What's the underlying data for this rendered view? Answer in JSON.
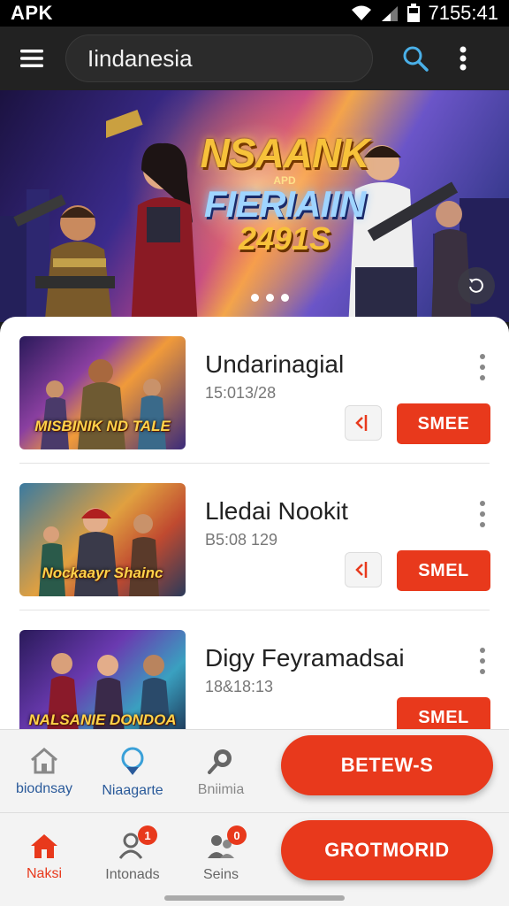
{
  "status_bar": {
    "carrier": "APK",
    "time": "7155:41"
  },
  "toolbar": {
    "search_value": "Iindanesia"
  },
  "banner": {
    "title_line1": "NSAANK",
    "title_line2": "APD",
    "title_line3": "FIERIAIIN",
    "title_line4": "2491S",
    "slide_count": 3
  },
  "games": [
    {
      "title": "Undarinagial",
      "time": "15:013/28",
      "thumb_caption": "MISBINIK ND TALE",
      "action_label": "SMEE"
    },
    {
      "title": "Lledai Nookit",
      "time": "B5:08 129",
      "thumb_caption": "Nockaayr Shainc",
      "action_label": "SMEL"
    },
    {
      "title": "Digy Feyramadsai",
      "time": "18&18:13",
      "thumb_caption": "NALSANIE DONDOA",
      "action_label": "SMEL"
    }
  ],
  "nav_top": [
    {
      "label": "biodnsay",
      "icon": "home-outline-icon",
      "color": "#2a5a9a"
    },
    {
      "label": "Niaagarte",
      "icon": "location-icon",
      "color": "#2a5a9a"
    },
    {
      "label": "Bniimia",
      "icon": "search-icon",
      "color": "#888888"
    }
  ],
  "nav_bottom": [
    {
      "label": "Naksi",
      "icon": "home-icon",
      "color": "#e8391c",
      "badge": ""
    },
    {
      "label": "Intonads",
      "icon": "user-icon",
      "color": "#666666",
      "badge": "1"
    },
    {
      "label": "Seins",
      "icon": "users-icon",
      "color": "#666666",
      "badge": "0"
    }
  ],
  "actions": {
    "primary_label": "BETEW-S",
    "secondary_label": "GROTMORID"
  },
  "colors": {
    "accent": "#e8391c",
    "toolbar": "#222222",
    "search_icon": "#4ab0e8"
  }
}
